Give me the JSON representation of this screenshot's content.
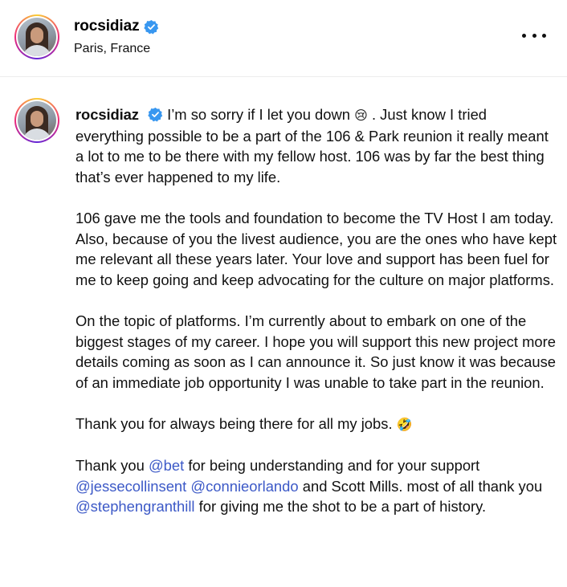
{
  "header": {
    "username": "rocsidiaz",
    "location": "Paris, France",
    "more_icon": "more-horizontal-icon"
  },
  "post": {
    "username": "rocsidiaz",
    "p1": {
      "text_a": "I’m so sorry if I let you down",
      "emoji_a": "😢",
      "text_b": ". Just know I tried everything possible to be a part of the 106 & Park reunion it really meant a lot to me to be there with my fellow host. 106 was by far the best thing that’s ever happened to my life."
    },
    "p2": "106 gave me the tools and foundation to become the TV Host I am today. Also, because of you the livest audience, you are the ones who have kept me relevant all these years later. Your love and support has been fuel for me to keep going and keep advocating for the culture on major platforms.",
    "p3": "On the topic of platforms. I’m currently about to embark on one of the biggest stages of my career. I hope you will support this new project more details coming as soon as I can announce it. So just know it was because of an immediate job opportunity I was unable to take part in the reunion.",
    "p4": {
      "text": "Thank you for always being there for all my jobs.",
      "emoji": "🤣"
    },
    "p5": {
      "t1": "Thank you ",
      "m1": "@bet",
      "t2": " for being understanding and for your support ",
      "m2": "@jessecollinsent",
      "t3": " ",
      "m3": "@connieorlando",
      "t4": " and Scott Mills. most of all thank you ",
      "m4": "@stephengranthill",
      "t5": " for giving me the shot to be a part of history."
    }
  },
  "colors": {
    "mention": "#3c59c7",
    "verified": "#3897f0"
  }
}
